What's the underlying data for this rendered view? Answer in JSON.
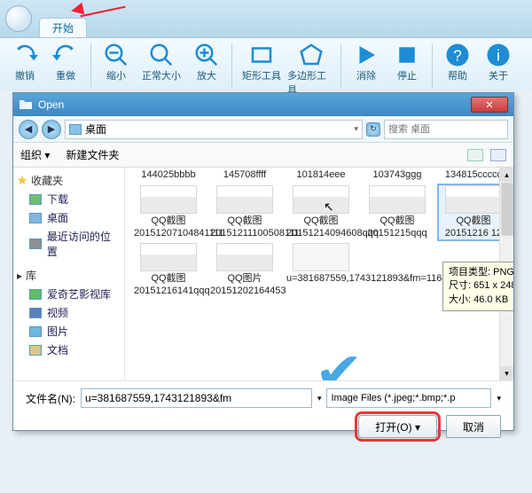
{
  "app": {
    "tab_label": "开始"
  },
  "ribbon": [
    {
      "id": "undo",
      "label": "撤销"
    },
    {
      "id": "redo",
      "label": "重做"
    },
    {
      "id": "zoom-out",
      "label": "缩小"
    },
    {
      "id": "zoom-fit",
      "label": "正常大小"
    },
    {
      "id": "zoom-in",
      "label": "放大"
    },
    {
      "id": "rect",
      "label": "矩形工具"
    },
    {
      "id": "polygon",
      "label": "多边形工具"
    },
    {
      "id": "cancel",
      "label": "消除"
    },
    {
      "id": "stop",
      "label": "停止"
    },
    {
      "id": "help",
      "label": "帮助"
    },
    {
      "id": "about",
      "label": "关于"
    }
  ],
  "dialog": {
    "title": "Open",
    "breadcrumb": "桌面",
    "search_placeholder": "搜索 桌面",
    "toolbar": {
      "organize": "组织",
      "new_folder": "新建文件夹"
    },
    "sidebar": {
      "favorites": {
        "label": "收藏夹",
        "items": [
          "下载",
          "桌面",
          "最近访问的位置"
        ]
      },
      "library": {
        "label": "库",
        "items": [
          "爱奇艺影视库",
          "视频",
          "图片",
          "文档"
        ]
      }
    },
    "files": {
      "row1": [
        {
          "name": "144025bbbb"
        },
        {
          "name": "145708ffff"
        },
        {
          "name": "101814eee"
        },
        {
          "name": "103743ggg"
        },
        {
          "name": "134815ccccc"
        }
      ],
      "row2": [
        {
          "name": "QQ截图20151207104841111"
        },
        {
          "name": "QQ截图20151211100508111"
        },
        {
          "name": "QQ截图20151214094608qqq"
        },
        {
          "name": "QQ截图20151215qqq"
        },
        {
          "name": "QQ截图20151216 12"
        }
      ],
      "row3": [
        {
          "name": "QQ截图20151216141qqq"
        },
        {
          "name": "QQ图片20151202164453"
        },
        {
          "name": "u=381687559,1743121893&fm=116&g..."
        }
      ]
    },
    "tooltip": {
      "line1": "项目类型: PNG 图像",
      "line2": "尺寸: 651 x 248",
      "line3": "大小: 46.0 KB"
    },
    "filename_label": "文件名(N):",
    "filename_value": "u=381687559,1743121893&fm",
    "filter_value": "Image Files (*.jpeg;*.bmp;*.p",
    "open_btn": "打开(O)",
    "cancel_btn": "取消"
  }
}
